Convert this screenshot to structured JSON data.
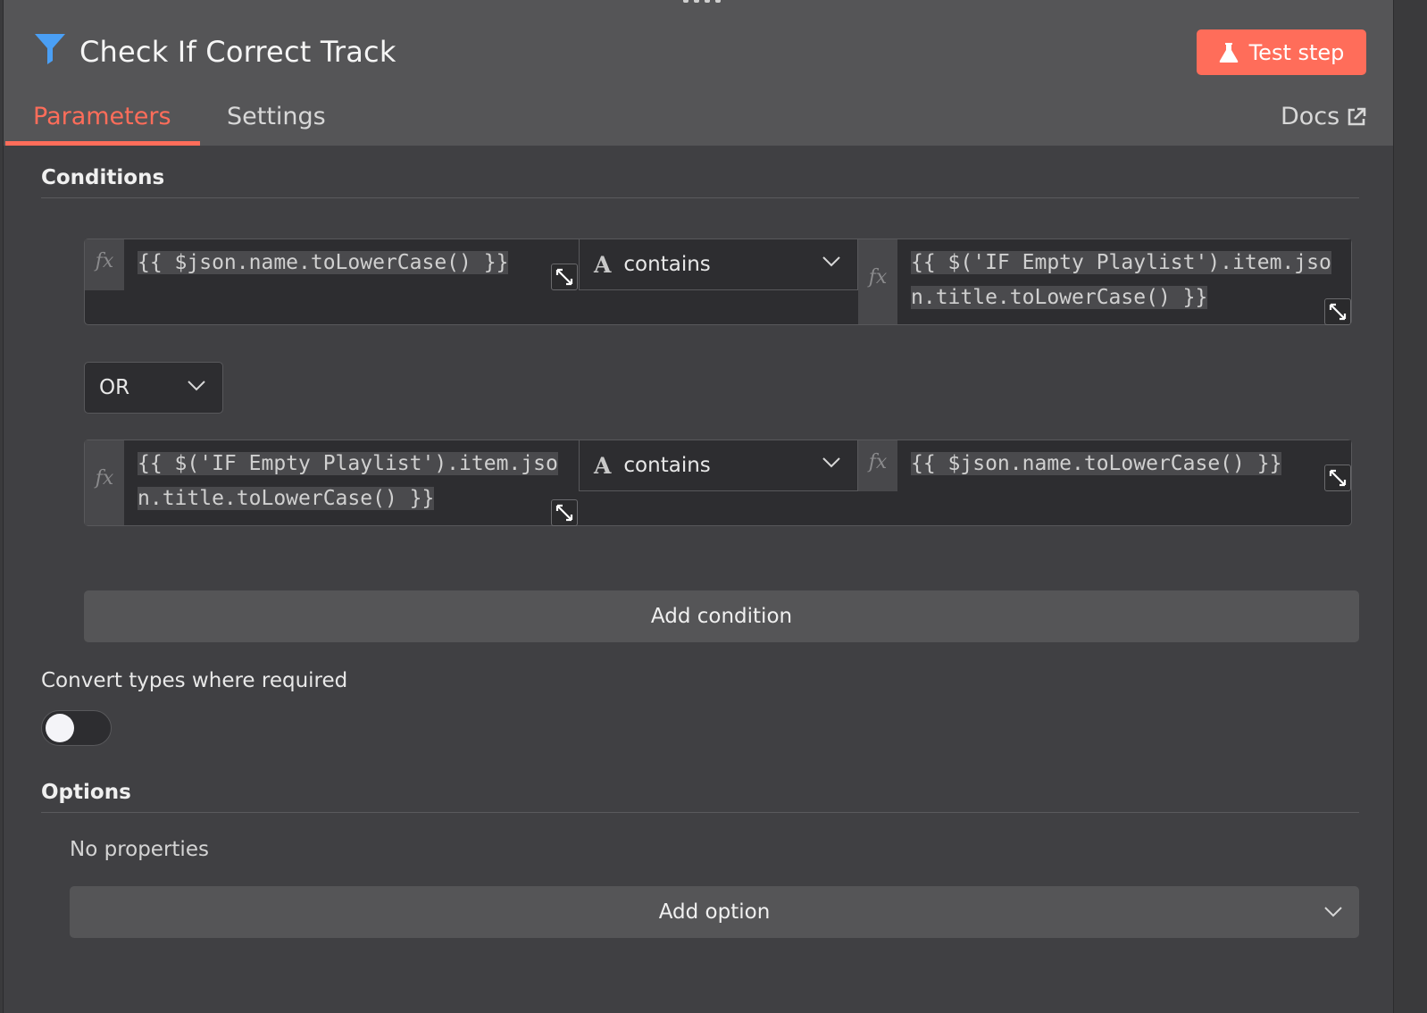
{
  "node": {
    "title": "Check If Correct Track",
    "icon": "filter-icon",
    "test_button_label": "Test step"
  },
  "tabs": [
    {
      "label": "Parameters",
      "active": true
    },
    {
      "label": "Settings",
      "active": false
    }
  ],
  "docs_label": "Docs",
  "conditions": {
    "section_title": "Conditions",
    "fx_label": "fx",
    "rows": [
      {
        "left_value": "{{ $json.name.toLowerCase() }}",
        "operator_type": "A",
        "operator": "contains",
        "right_value_line1": "{{ $('IF Empty Playlist').item.jso",
        "right_value_line2": "n.title.toLowerCase() }}"
      },
      {
        "left_value_line1": "{{ $('IF Empty Playlist').item.jso",
        "left_value_line2": "n.title.toLowerCase() }}",
        "operator_type": "A",
        "operator": "contains",
        "right_value": "{{ $json.name.toLowerCase() }}"
      }
    ],
    "combinator": "OR",
    "add_condition_label": "Add condition"
  },
  "convert_types": {
    "label": "Convert types where required",
    "enabled": false
  },
  "options": {
    "section_title": "Options",
    "empty_text": "No properties",
    "add_option_label": "Add option"
  },
  "colors": {
    "accent": "#ff6d5a",
    "panel_bg": "#404043",
    "header_bg": "#555557",
    "filter_icon": "#4a9ff5"
  }
}
